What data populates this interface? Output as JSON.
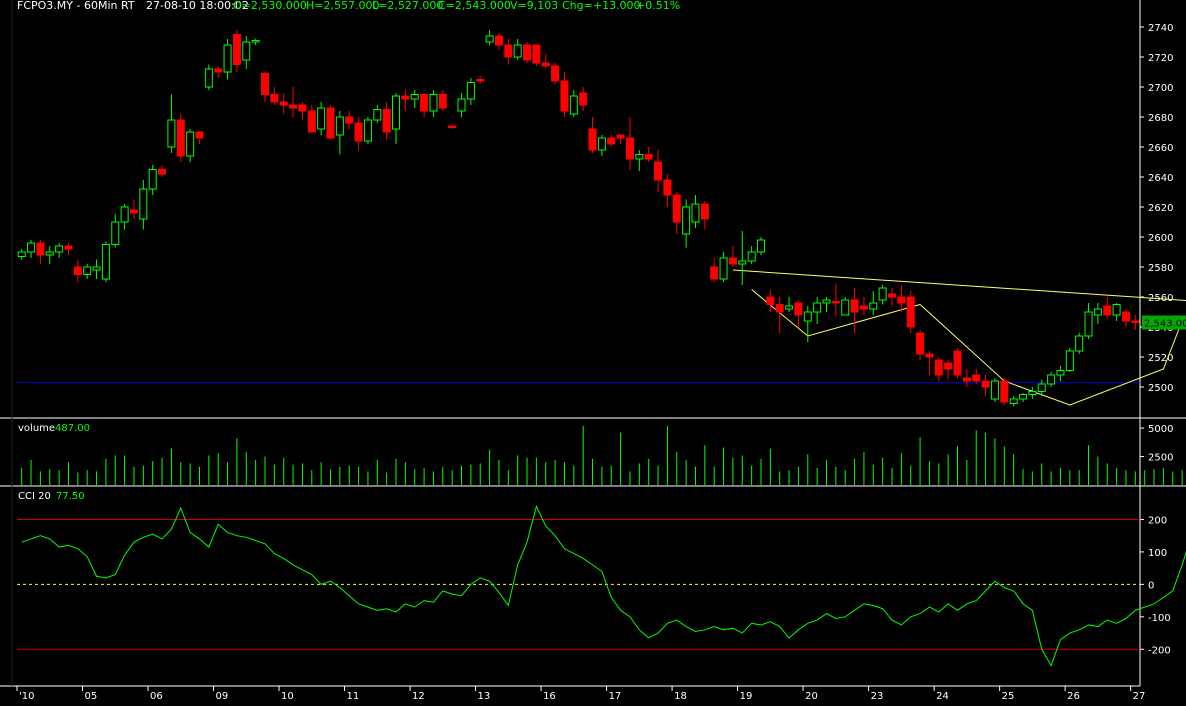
{
  "header": {
    "symbol": "FCPO3.MY - 60Min RT",
    "datetime": "27-08-10  18:00:02",
    "ohlc": [
      "O=2,530.000",
      "H=2,557.000",
      "L=2,527.000",
      "C=2,543.000",
      "V=9,103",
      "Chg=+13.000",
      "+0.51%"
    ]
  },
  "colors": {
    "background": "#000000",
    "up": "#00ff00",
    "down": "#ff0000",
    "axis_text": "#ffffff",
    "indicator_value": "#00ff00",
    "trendline": "#ffff66",
    "support_line": "#0000cc",
    "cci_bounds": "#cc0000",
    "zero_line": "#ffff00",
    "border": "#ffffff"
  },
  "chart_data": [
    {
      "type": "candlestick",
      "ylim": [
        2480,
        2750
      ],
      "y_ticks": [
        2500,
        2520,
        2540,
        2560,
        2580,
        2600,
        2620,
        2640,
        2660,
        2680,
        2700,
        2720,
        2740
      ],
      "last_price_label": "2,543.00",
      "last_price": 2543,
      "horizontal_line": 2503,
      "x_tick_labels": [
        "'10",
        "05",
        "06",
        "09",
        "10",
        "11",
        "12",
        "13",
        "16",
        "17",
        "18",
        "19",
        "20",
        "23",
        "24",
        "25",
        "26",
        "27"
      ],
      "x_tick_positions": [
        0,
        7,
        14,
        21,
        28,
        35,
        42,
        49,
        56,
        63,
        70,
        77,
        84,
        91,
        98,
        105,
        112,
        119
      ],
      "candles": [
        [
          2587,
          2592,
          2585,
          2590
        ],
        [
          2590,
          2598,
          2586,
          2596
        ],
        [
          2596,
          2598,
          2582,
          2588
        ],
        [
          2588,
          2594,
          2582,
          2590
        ],
        [
          2590,
          2596,
          2586,
          2594
        ],
        [
          2594,
          2596,
          2588,
          2592
        ],
        [
          2580,
          2585,
          2570,
          2575
        ],
        [
          2575,
          2582,
          2572,
          2580
        ],
        [
          2578,
          2585,
          2572,
          2580
        ],
        [
          2572,
          2597,
          2570,
          2595
        ],
        [
          2595,
          2615,
          2593,
          2610
        ],
        [
          2610,
          2622,
          2605,
          2620
        ],
        [
          2618,
          2625,
          2612,
          2616
        ],
        [
          2612,
          2638,
          2605,
          2632
        ],
        [
          2632,
          2648,
          2628,
          2645
        ],
        [
          2645,
          2648,
          2640,
          2642
        ],
        [
          2660,
          2695,
          2656,
          2678
        ],
        [
          2678,
          2682,
          2650,
          2654
        ],
        [
          2654,
          2672,
          2650,
          2670
        ],
        [
          2670,
          2665,
          2662,
          2666
        ],
        [
          2700,
          2715,
          2698,
          2712
        ],
        [
          2712,
          2714,
          2706,
          2710
        ],
        [
          2710,
          2732,
          2705,
          2728
        ],
        [
          2735,
          2738,
          2710,
          2715
        ],
        [
          2718,
          2734,
          2712,
          2730
        ],
        [
          2730,
          2732,
          2728,
          2731
        ],
        [
          2709,
          2710,
          2690,
          2695
        ],
        [
          2695,
          2700,
          2688,
          2690
        ],
        [
          2690,
          2696,
          2682,
          2688
        ],
        [
          2688,
          2700,
          2680,
          2686
        ],
        [
          2688,
          2690,
          2678,
          2684
        ],
        [
          2684,
          2688,
          2670,
          2670
        ],
        [
          2672,
          2690,
          2668,
          2686
        ],
        [
          2686,
          2688,
          2665,
          2666
        ],
        [
          2668,
          2684,
          2655,
          2680
        ],
        [
          2680,
          2684,
          2672,
          2676
        ],
        [
          2676,
          2680,
          2658,
          2664
        ],
        [
          2664,
          2680,
          2662,
          2678
        ],
        [
          2678,
          2688,
          2676,
          2685
        ],
        [
          2685,
          2690,
          2665,
          2670
        ],
        [
          2672,
          2696,
          2662,
          2694
        ],
        [
          2694,
          2698,
          2684,
          2692
        ],
        [
          2692,
          2698,
          2686,
          2695
        ],
        [
          2695,
          2696,
          2680,
          2684
        ],
        [
          2684,
          2698,
          2680,
          2695
        ],
        [
          2695,
          2698,
          2684,
          2686
        ],
        [
          2674,
          2674,
          2672,
          2673
        ],
        [
          2684,
          2696,
          2680,
          2692
        ],
        [
          2692,
          2706,
          2688,
          2703
        ],
        [
          2705,
          2707,
          2702,
          2704
        ],
        [
          2730,
          2738,
          2728,
          2734
        ],
        [
          2734,
          2736,
          2725,
          2728
        ],
        [
          2728,
          2732,
          2715,
          2720
        ],
        [
          2720,
          2732,
          2718,
          2728
        ],
        [
          2728,
          2730,
          2716,
          2718
        ],
        [
          2728,
          2728,
          2714,
          2716
        ],
        [
          2716,
          2722,
          2712,
          2714
        ],
        [
          2714,
          2716,
          2702,
          2704
        ],
        [
          2704,
          2710,
          2680,
          2684
        ],
        [
          2682,
          2698,
          2680,
          2694
        ],
        [
          2696,
          2700,
          2684,
          2688
        ],
        [
          2672,
          2680,
          2656,
          2658
        ],
        [
          2658,
          2668,
          2654,
          2666
        ],
        [
          2666,
          2668,
          2660,
          2662
        ],
        [
          2668,
          2668,
          2662,
          2666
        ],
        [
          2666,
          2680,
          2645,
          2652
        ],
        [
          2652,
          2658,
          2644,
          2655
        ],
        [
          2655,
          2660,
          2650,
          2652
        ],
        [
          2650,
          2658,
          2630,
          2638
        ],
        [
          2638,
          2642,
          2620,
          2628
        ],
        [
          2628,
          2630,
          2602,
          2610
        ],
        [
          2602,
          2625,
          2593,
          2620
        ],
        [
          2610,
          2628,
          2606,
          2622
        ],
        [
          2622,
          2624,
          2605,
          2612
        ],
        [
          2580,
          2586,
          2570,
          2572
        ],
        [
          2572,
          2590,
          2570,
          2586
        ],
        [
          2586,
          2594,
          2580,
          2582
        ],
        [
          2582,
          2604,
          2568,
          2584
        ],
        [
          2584,
          2594,
          2582,
          2590
        ],
        [
          2590,
          2600,
          2588,
          2598
        ],
        [
          2560,
          2565,
          2550,
          2555
        ],
        [
          2555,
          2560,
          2536,
          2550
        ],
        [
          2552,
          2560,
          2550,
          2554
        ],
        [
          2556,
          2558,
          2540,
          2548
        ],
        [
          2544,
          2554,
          2530,
          2550
        ],
        [
          2550,
          2560,
          2542,
          2556
        ],
        [
          2556,
          2560,
          2550,
          2558
        ],
        [
          2557,
          2569,
          2547,
          2556
        ],
        [
          2548,
          2560,
          2548,
          2558
        ],
        [
          2558,
          2566,
          2536,
          2550
        ],
        [
          2554,
          2560,
          2548,
          2552
        ],
        [
          2552,
          2564,
          2548,
          2556
        ],
        [
          2558,
          2568,
          2555,
          2566
        ],
        [
          2562,
          2566,
          2554,
          2560
        ],
        [
          2560,
          2568,
          2550,
          2556
        ],
        [
          2560,
          2564,
          2536,
          2540
        ],
        [
          2536,
          2538,
          2518,
          2522
        ],
        [
          2522,
          2524,
          2508,
          2520
        ],
        [
          2518,
          2520,
          2504,
          2508
        ],
        [
          2516,
          2518,
          2505,
          2512
        ],
        [
          2524,
          2526,
          2506,
          2508
        ],
        [
          2506,
          2512,
          2500,
          2504
        ],
        [
          2508,
          2512,
          2502,
          2504
        ],
        [
          2504,
          2508,
          2494,
          2500
        ],
        [
          2492,
          2506,
          2490,
          2504
        ],
        [
          2504,
          2506,
          2488,
          2490
        ],
        [
          2489,
          2494,
          2487,
          2492
        ],
        [
          2492,
          2496,
          2490,
          2495
        ],
        [
          2495,
          2500,
          2492,
          2497
        ],
        [
          2497,
          2505,
          2494,
          2502
        ],
        [
          2502,
          2510,
          2500,
          2508
        ],
        [
          2508,
          2514,
          2504,
          2511
        ],
        [
          2511,
          2526,
          2510,
          2524
        ],
        [
          2524,
          2536,
          2522,
          2534
        ],
        [
          2534,
          2556,
          2532,
          2550
        ],
        [
          2548,
          2556,
          2542,
          2552
        ],
        [
          2554,
          2560,
          2546,
          2548
        ],
        [
          2548,
          2556,
          2544,
          2555
        ],
        [
          2550,
          2552,
          2540,
          2544
        ],
        [
          2544,
          2548,
          2538,
          2543
        ]
      ],
      "trendlines": [
        {
          "points": [
            [
              76,
              2578
            ],
            [
              126,
              2557
            ]
          ]
        },
        {
          "points": [
            [
              78,
              2565
            ],
            [
              84,
              2534
            ],
            [
              96,
              2555
            ]
          ]
        },
        {
          "points": [
            [
              96,
              2555
            ],
            [
              105,
              2504
            ],
            [
              112,
              2488
            ],
            [
              122,
              2512
            ],
            [
              124,
              2544
            ],
            [
              126,
              2537
            ],
            [
              131,
              2548
            ]
          ]
        }
      ]
    },
    {
      "type": "bar",
      "title": "volume",
      "current_value": "487.00",
      "ylim": [
        0,
        5800
      ],
      "y_ticks": [
        2500,
        5000
      ],
      "values": [
        1500,
        2200,
        1200,
        1400,
        1300,
        2000,
        1100,
        1300,
        1200,
        2300,
        2600,
        2600,
        1600,
        1700,
        2100,
        2400,
        3200,
        2000,
        1900,
        1600,
        2600,
        2800,
        2000,
        4100,
        2900,
        2200,
        2500,
        1800,
        2400,
        1800,
        1900,
        1300,
        2000,
        1400,
        1600,
        1700,
        1600,
        1200,
        2200,
        1100,
        2300,
        2000,
        1400,
        1500,
        1200,
        1600,
        1300,
        1700,
        1800,
        1900,
        3100,
        2200,
        1300,
        2600,
        2400,
        2400,
        2000,
        2200,
        2000,
        1700,
        5200,
        2300,
        1600,
        1700,
        4600,
        1200,
        1900,
        2300,
        1700,
        5200,
        2900,
        2200,
        1600,
        3500,
        1600,
        3300,
        2400,
        2600,
        1700,
        2300,
        3200,
        1200,
        1300,
        1600,
        2700,
        1500,
        2200,
        1600,
        1300,
        2300,
        2900,
        1800,
        2400,
        1500,
        2800,
        1700,
        4200,
        2100,
        1900,
        2700,
        3400,
        2200,
        4800,
        4600,
        4100,
        3400,
        2700,
        1400,
        1200,
        1900,
        1200,
        1500,
        1300,
        1300,
        3500,
        2500,
        1900,
        1500,
        1300,
        1200,
        1300,
        1400,
        1500,
        1200,
        1300,
        2100,
        1400,
        1500,
        1200,
        800
      ]
    },
    {
      "type": "line",
      "title": "CCI 20",
      "current_value": "77.50",
      "ylim": [
        -310,
        300
      ],
      "y_ticks": [
        -200,
        -100,
        0,
        100,
        200
      ],
      "bounds": [
        200,
        -200
      ],
      "zero_line": 0,
      "values": [
        130,
        140,
        150,
        140,
        115,
        120,
        110,
        85,
        25,
        20,
        30,
        90,
        130,
        145,
        155,
        140,
        170,
        235,
        160,
        140,
        115,
        185,
        160,
        150,
        145,
        135,
        125,
        95,
        80,
        60,
        45,
        30,
        0,
        10,
        -10,
        -35,
        -60,
        -70,
        -80,
        -75,
        -85,
        -60,
        -70,
        -50,
        -55,
        -20,
        -30,
        -35,
        0,
        20,
        10,
        -25,
        -65,
        60,
        130,
        240,
        180,
        150,
        110,
        95,
        80,
        60,
        40,
        -40,
        -80,
        -100,
        -140,
        -165,
        -150,
        -120,
        -110,
        -130,
        -145,
        -140,
        -130,
        -140,
        -135,
        -150,
        -120,
        -125,
        -115,
        -130,
        -165,
        -140,
        -120,
        -110,
        -90,
        -105,
        -100,
        -80,
        -60,
        -65,
        -75,
        -110,
        -125,
        -100,
        -90,
        -70,
        -85,
        -60,
        -80,
        -60,
        -50,
        -20,
        10,
        -10,
        -20,
        -60,
        -80,
        -200,
        -250,
        -170,
        -150,
        -140,
        -125,
        -130,
        -110,
        -120,
        -105,
        -80,
        -70,
        -60,
        -40,
        -20,
        60,
        150,
        210,
        160,
        130,
        100,
        95,
        77.5
      ]
    }
  ]
}
